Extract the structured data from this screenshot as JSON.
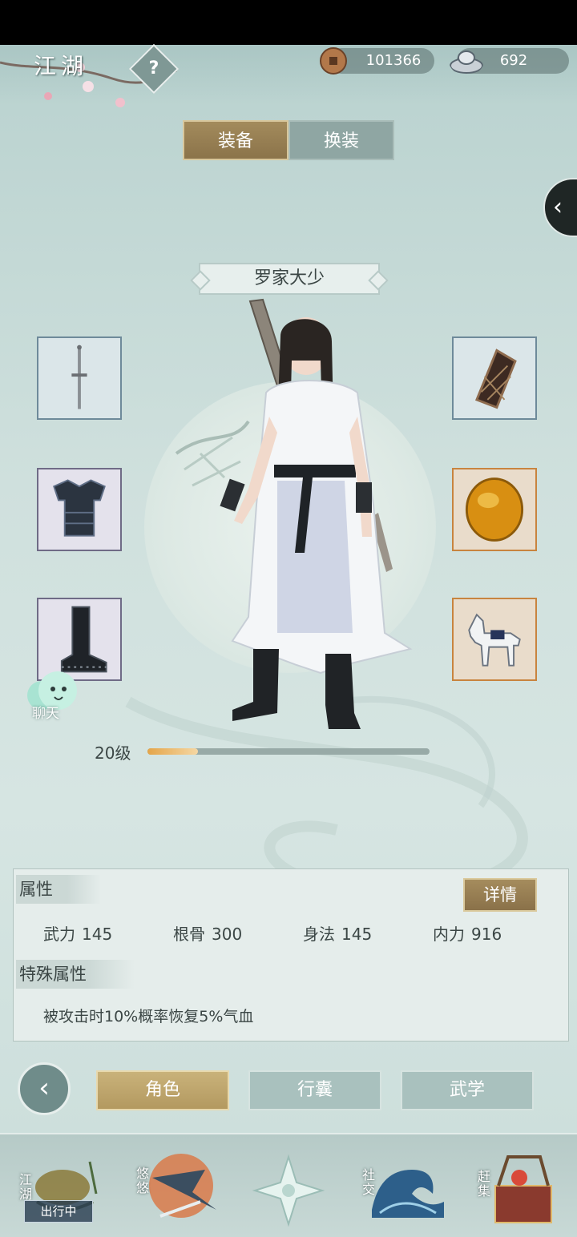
{
  "header": {
    "title": "江湖",
    "help_icon": "?",
    "copper": "101366",
    "silver": "692"
  },
  "tabs_top": {
    "equip": "装备",
    "outfit": "换装"
  },
  "character": {
    "name": "罗家大少",
    "level_text": "20级",
    "level_progress": 0.18
  },
  "slots": {
    "left": [
      "sword-icon",
      "armor-icon",
      "boots-icon"
    ],
    "right": [
      "bracer-icon",
      "amber-gem-icon",
      "horse-icon"
    ]
  },
  "chat": {
    "label": "聊天"
  },
  "attributes": {
    "title": "属性",
    "detail_button": "详情",
    "stats": [
      {
        "name": "武力",
        "value": "145"
      },
      {
        "name": "根骨",
        "value": "300"
      },
      {
        "name": "身法",
        "value": "145"
      },
      {
        "name": "内力",
        "value": "916"
      }
    ],
    "special_title": "特殊属性",
    "special_text": "被攻击时10%概率恢复5%气血"
  },
  "bottom_tabs": {
    "role": "角色",
    "bag": "行囊",
    "martial": "武学"
  },
  "nav": {
    "jianghu": "江湖",
    "youyou": "悠悠",
    "social": "社交",
    "market": "赶集",
    "status": "出行中"
  },
  "colors": {
    "accent_gold": "#a38b5c",
    "panel_bg": "#e5edeb",
    "level_fill": "#e4a549"
  }
}
